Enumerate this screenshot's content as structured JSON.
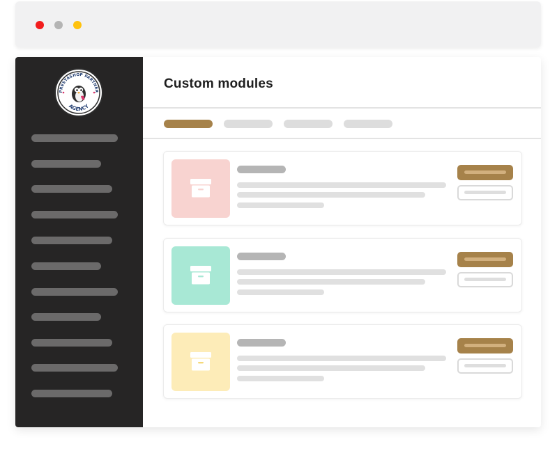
{
  "window_controls": {
    "close_color": "#f21d1d",
    "minimize_color": "#b4b4b4",
    "maximize_color": "#ffc20e"
  },
  "sidebar": {
    "background": "#262525",
    "item_color": "#6b6a6a",
    "logo": {
      "arc_text_top": "PRESTASHOP PARTNER",
      "arc_text_bottom": "AGENCY",
      "icon": "prestashop-penguin-icon"
    },
    "item_count": 11
  },
  "main": {
    "title": "Custom modules",
    "tabs": [
      {
        "state": "active",
        "color": "#a6824a"
      },
      {
        "state": "inactive",
        "color": "#dddddd"
      },
      {
        "state": "inactive",
        "color": "#dddddd"
      },
      {
        "state": "inactive",
        "color": "#dddddd"
      }
    ],
    "modules": [
      {
        "thumb_color": "#f8d3d0",
        "icon": "archive-box-icon",
        "icon_accent": "#f8d3d0"
      },
      {
        "thumb_color": "#a8e8d5",
        "icon": "archive-box-icon",
        "icon_accent": "#a8e8d5"
      },
      {
        "thumb_color": "#fdecb8",
        "icon": "archive-box-icon",
        "icon_accent": "#f5d97a"
      }
    ],
    "primary_button_color": "#a6824a",
    "primary_button_bar_color": "#d2b07e"
  }
}
